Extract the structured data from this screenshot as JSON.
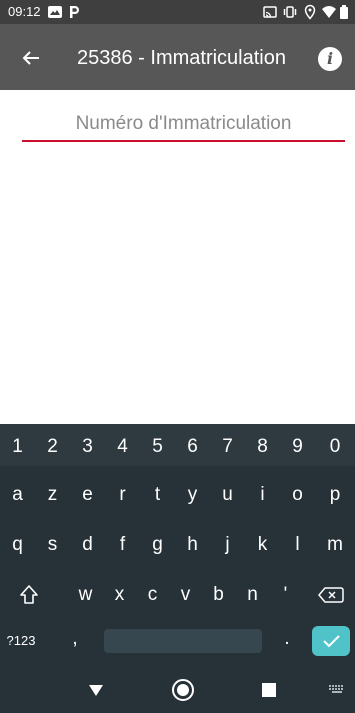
{
  "status_bar": {
    "time": "09:12",
    "left_icons": [
      "photos-icon",
      "parking-p-icon"
    ],
    "right_icons": [
      "cast-icon",
      "vibrate-icon",
      "location-icon",
      "wifi-icon",
      "battery-icon"
    ]
  },
  "app_bar": {
    "title": "25386 - Immatriculation",
    "back_icon": "arrow-left-icon",
    "info_icon": "info-icon",
    "info_glyph": "i"
  },
  "form": {
    "registration_placeholder": "Numéro d'Immatriculation",
    "registration_value": ""
  },
  "keyboard": {
    "number_row": [
      "1",
      "2",
      "3",
      "4",
      "5",
      "6",
      "7",
      "8",
      "9",
      "0"
    ],
    "row1": [
      "a",
      "z",
      "e",
      "r",
      "t",
      "y",
      "u",
      "i",
      "o",
      "p"
    ],
    "row2": [
      "q",
      "s",
      "d",
      "f",
      "g",
      "h",
      "j",
      "k",
      "l",
      "m"
    ],
    "row3": [
      "w",
      "x",
      "c",
      "v",
      "b",
      "n",
      "'"
    ],
    "symbols_label": "?123",
    "comma": ",",
    "period": "."
  },
  "nav_bar": {
    "icons": [
      "back-triangle-icon",
      "home-circle-icon",
      "recents-square-icon",
      "keyboard-switch-icon"
    ]
  },
  "colors": {
    "status_bar": "#3f3f3f",
    "app_bar": "#575757",
    "underline": "#c8102e",
    "keyboard_bg": "#263238",
    "enter_key": "#4fc3c7"
  }
}
